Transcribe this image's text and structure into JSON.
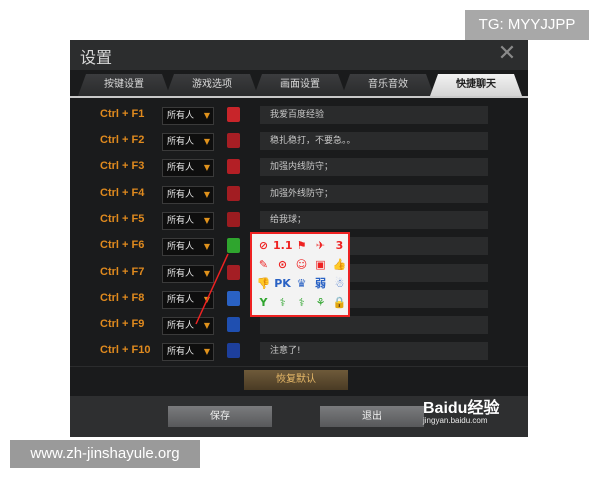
{
  "badges": {
    "tg": "TG: MYYJJPP",
    "site": "www.zh-jinshayule.org"
  },
  "window": {
    "title": "设置",
    "close": "✕"
  },
  "tabs": [
    {
      "label": "按键设置",
      "active": false
    },
    {
      "label": "游戏选项",
      "active": false
    },
    {
      "label": "画面设置",
      "active": false
    },
    {
      "label": "音乐音效",
      "active": false
    },
    {
      "label": "快捷聊天",
      "active": true
    }
  ],
  "rows": [
    {
      "key": "Ctrl + F1",
      "who": "所有人",
      "msg": "我爱百度经验",
      "emote": "#c8252a"
    },
    {
      "key": "Ctrl + F2",
      "who": "所有人",
      "msg": "稳扎稳打，不要急。。",
      "emote": "#a61e24"
    },
    {
      "key": "Ctrl + F3",
      "who": "所有人",
      "msg": "加强内线防守；",
      "emote": "#b31f25"
    },
    {
      "key": "Ctrl + F4",
      "who": "所有人",
      "msg": "加强外线防守；",
      "emote": "#a21d22"
    },
    {
      "key": "Ctrl + F5",
      "who": "所有人",
      "msg": "给我球；",
      "emote": "#9b1c20"
    },
    {
      "key": "Ctrl + F6",
      "who": "所有人",
      "msg": "",
      "emote": "#2fa52e"
    },
    {
      "key": "Ctrl + F7",
      "who": "所有人",
      "msg": "",
      "emote": "#a41e24"
    },
    {
      "key": "Ctrl + F8",
      "who": "所有人",
      "msg": "",
      "emote": "#2a62c4"
    },
    {
      "key": "Ctrl + F9",
      "who": "所有人",
      "msg": "",
      "emote": "#1f4fb0"
    },
    {
      "key": "Ctrl + F10",
      "who": "所有人",
      "msg": "注意了!",
      "emote": "#1d3f9c"
    }
  ],
  "emote_grid": [
    [
      "⊘",
      "1.1",
      "⚑",
      "✈",
      "3"
    ],
    [
      "✎",
      "⊙",
      "☺",
      "▣",
      "👍"
    ],
    [
      "👎",
      "PK",
      "♛",
      "弱",
      "☃"
    ],
    [
      "Y",
      "⚕",
      "⚕",
      "⚘",
      "🔒"
    ]
  ],
  "emote_colors": [
    [
      "#e22",
      "#e22",
      "#e22",
      "#e22",
      "#e22"
    ],
    [
      "#e22",
      "#e22",
      "#e22",
      "#e22",
      "#2a62c4"
    ],
    [
      "#2a62c4",
      "#2a62c4",
      "#2a62c4",
      "#2a62c4",
      "#2a62c4"
    ],
    [
      "#2fa52e",
      "#2fa52e",
      "#2fa52e",
      "#2fa52e",
      "#2fa52e"
    ]
  ],
  "buttons": {
    "reset": "恢复默认",
    "save": "保存",
    "exit": "退出"
  },
  "watermark": {
    "brand": "Baidu经验",
    "url": "jingyan.baidu.com"
  }
}
